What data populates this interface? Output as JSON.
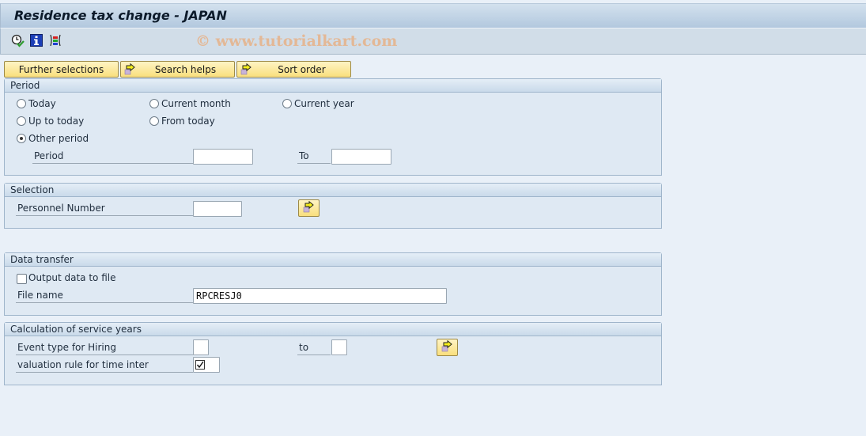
{
  "window": {
    "title": "Residence tax change - JAPAN",
    "watermark": "© www.tutorialkart.com"
  },
  "toolbar": {
    "icons": [
      "execute-icon",
      "info-icon",
      "get-variant-icon"
    ]
  },
  "selection_buttons": [
    {
      "label": "Further selections",
      "icon": null
    },
    {
      "label": "Search helps",
      "icon": "arrow-right-icon"
    },
    {
      "label": "Sort order",
      "icon": "arrow-right-icon"
    }
  ],
  "period": {
    "title": "Period",
    "options": [
      {
        "label": "Today",
        "selected": false
      },
      {
        "label": "Current month",
        "selected": false
      },
      {
        "label": "Current year",
        "selected": false
      },
      {
        "label": "Up to today",
        "selected": false
      },
      {
        "label": "From today",
        "selected": false
      },
      {
        "label": "Other period",
        "selected": true
      }
    ],
    "period_label": "Period",
    "period_from": "",
    "to_label": "To",
    "period_to": ""
  },
  "selection": {
    "title": "Selection",
    "personnel_number_label": "Personnel Number",
    "personnel_number": ""
  },
  "data_transfer": {
    "title": "Data transfer",
    "output_to_file_label": "Output data to file",
    "output_to_file_checked": false,
    "file_name_label": "File name",
    "file_name": "RPCRESJ0"
  },
  "service_years": {
    "title": "Calculation of service years",
    "event_type_label": "Event type for Hiring",
    "event_type_from": "",
    "to_label": "to",
    "event_type_to": "",
    "valuation_rule_label": "valuation rule for time inter",
    "valuation_rule_checked": true
  }
}
